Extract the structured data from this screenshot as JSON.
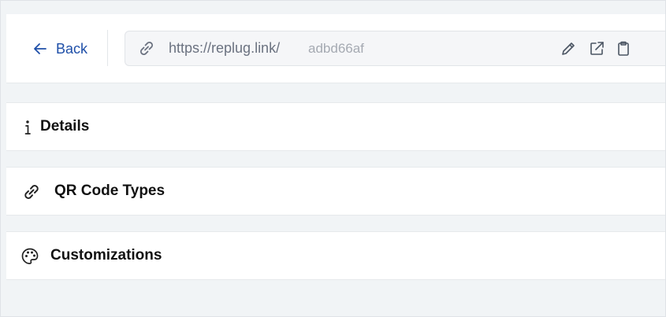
{
  "header": {
    "back_label": "Back",
    "url_prefix": "https://replug.link/",
    "url_slug": "adbd66af"
  },
  "sections": [
    {
      "label": "Details",
      "icon": "info-icon"
    },
    {
      "label": "QR Code Types",
      "icon": "link-icon"
    },
    {
      "label": "Customizations",
      "icon": "palette-icon"
    }
  ]
}
